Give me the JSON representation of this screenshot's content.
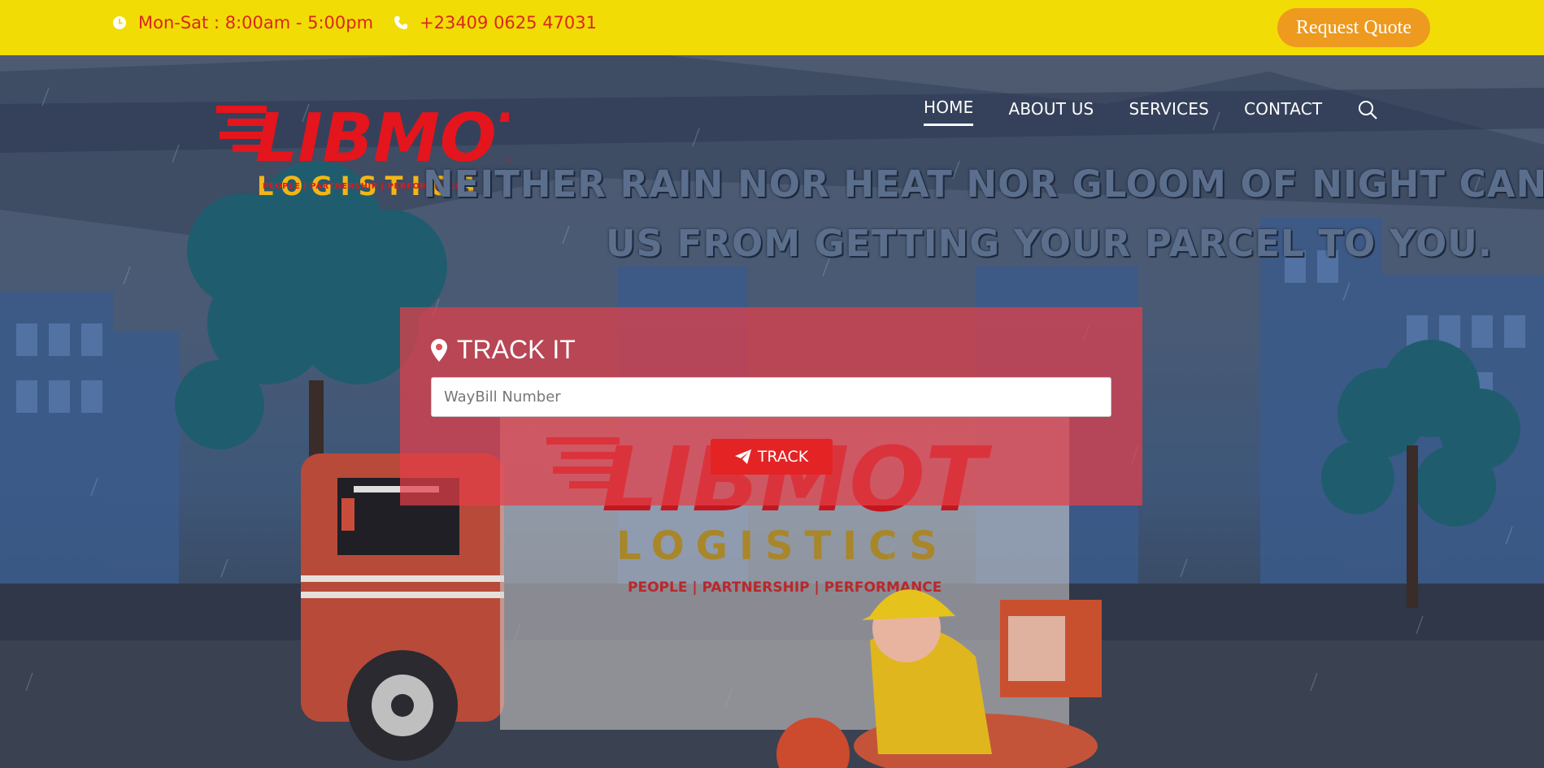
{
  "topbar": {
    "hours": "Mon-Sat : 8:00am - 5:00pm",
    "phone": "+23409 0625 47031",
    "quote_label": "Request Quote",
    "icons": {
      "hours": "clock-icon",
      "phone": "phone-icon"
    }
  },
  "logo": {
    "word": "LIBMOT",
    "sub": "LOGISTICS",
    "tagline": "PEOPLE | PARTNERSHIP | PERFORMANCE"
  },
  "nav": {
    "items": [
      {
        "label": "HOME",
        "active": true
      },
      {
        "label": "ABOUT US",
        "active": false
      },
      {
        "label": "SERVICES",
        "active": false
      },
      {
        "label": "CONTACT",
        "active": false
      }
    ],
    "search_icon": "search-icon"
  },
  "hero": {
    "slogan_line1": "NEITHER RAIN NOR HEAT NOR GLOOM OF NIGHT CAN STO",
    "slogan_line2": "US FROM GETTING YOUR PARCEL TO YOU.",
    "truck_brand": "LIBMOT",
    "truck_sub": "LOGISTICS",
    "truck_tagline": "PEOPLE | PARTNERSHIP | PERFORMANCE"
  },
  "tracker": {
    "title": "TRACK IT",
    "title_icon": "map-marker-icon",
    "input_placeholder": "WayBill Number",
    "input_value": "",
    "button_label": "TRACK",
    "button_icon": "paper-plane-icon"
  },
  "colors": {
    "topbar_bg": "#f2dc05",
    "accent_red": "#e42325",
    "quote_orange": "#ed9a1f",
    "logo_yellow": "#f2b616"
  }
}
